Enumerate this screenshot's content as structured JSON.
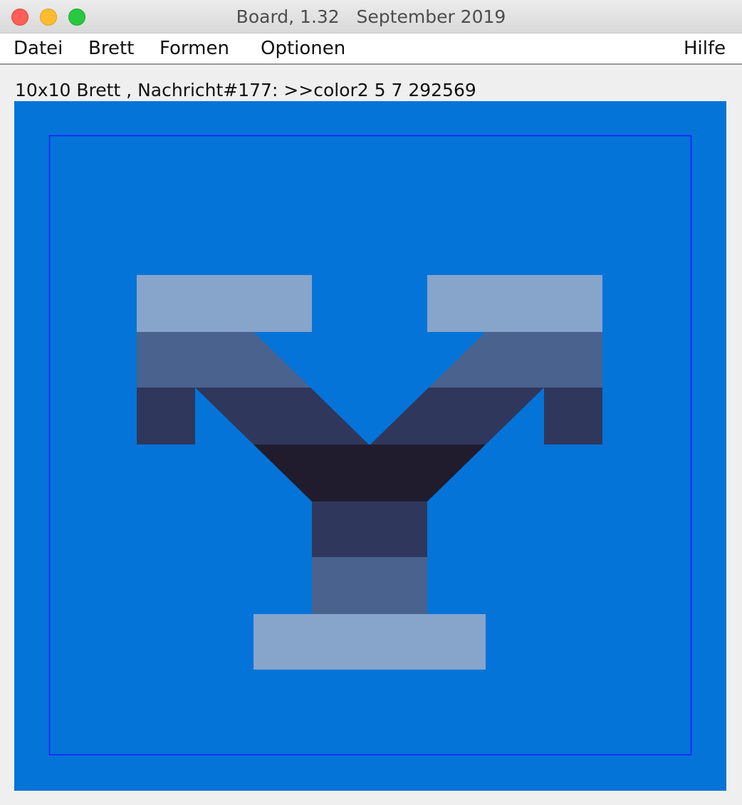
{
  "window": {
    "title": "Board, 1.32   September 2019",
    "buttons": [
      "close",
      "minimize",
      "zoom"
    ]
  },
  "menu": {
    "items": [
      {
        "label": "Datei"
      },
      {
        "label": "Brett"
      },
      {
        "label": "Formen"
      },
      {
        "label": "Optionen"
      }
    ],
    "help": "Hilfe"
  },
  "status": {
    "text": "10x10 Brett , Nachricht#177: >>color2 5 7 292569"
  },
  "board": {
    "background": "#0474d8",
    "frame_color": "#1a1aff",
    "colors": {
      "light": "#87a4cb",
      "mid": "#4a628e",
      "dark": "#30375c",
      "darkest": "#201c2e"
    },
    "icon": "y-shaped-figure"
  }
}
